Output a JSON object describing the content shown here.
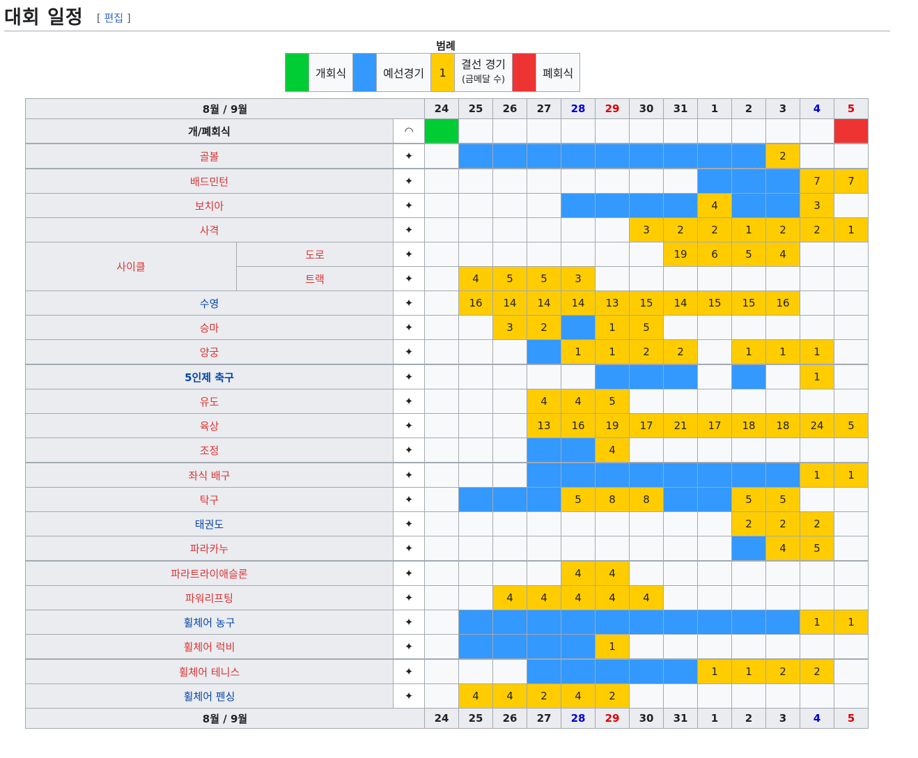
{
  "section": {
    "title": "대회 일정",
    "edit_open": "[",
    "edit_link": "편집",
    "edit_close": "]"
  },
  "legend": {
    "title": "범례",
    "opening": "개회식",
    "qualification": "예선경기",
    "final_number": "1",
    "final": "결선 경기",
    "final_sub": "(금메달 수)",
    "closing": "폐회식",
    "colors": {
      "opening": "#00cc33",
      "qualification": "#3399ff",
      "final": "#ffcc00",
      "closing": "#ee3333"
    }
  },
  "schedule": {
    "header_label": "8월 / 9월",
    "days": [
      "24",
      "25",
      "26",
      "27",
      "28",
      "29",
      "30",
      "31",
      "1",
      "2",
      "3",
      "4",
      "5"
    ],
    "ceremonies": {
      "label": "개/폐회식",
      "icon": "paralympic-agitos-icon"
    },
    "rows": [
      {
        "name": "골볼",
        "icon": "goalball-icon",
        "cells": [
          "",
          "Q",
          "Q",
          "Q",
          "Q",
          "Q",
          "Q",
          "Q",
          "Q",
          "Q",
          "2",
          "",
          ""
        ]
      },
      {
        "name": "배드민턴",
        "icon": "badminton-icon",
        "cells": [
          "",
          "",
          "",
          "",
          "",
          "",
          "",
          "",
          "Q",
          "Q",
          "Q",
          "7",
          "7"
        ]
      },
      {
        "name": "보치아",
        "icon": "boccia-icon",
        "cells": [
          "",
          "",
          "",
          "",
          "Q",
          "Q",
          "Q",
          "Q",
          "4",
          "Q",
          "Q",
          "3",
          ""
        ]
      },
      {
        "name": "사격",
        "icon": "shooting-icon",
        "cells": [
          "",
          "",
          "",
          "",
          "",
          "",
          "3",
          "2",
          "2",
          "1",
          "2",
          "2",
          "1"
        ]
      },
      {
        "group": "사이클",
        "name": "도로",
        "icon": "road-cycling-icon",
        "cells": [
          "",
          "",
          "",
          "",
          "",
          "",
          "",
          "19",
          "6",
          "5",
          "4",
          "",
          ""
        ]
      },
      {
        "name": "트랙",
        "icon": "track-cycling-icon",
        "cells": [
          "",
          "4",
          "5",
          "5",
          "3",
          "",
          "",
          "",
          "",
          "",
          "",
          "",
          ""
        ]
      },
      {
        "name": "수영",
        "icon": "swimming-icon",
        "cells": [
          "",
          "16",
          "14",
          "14",
          "14",
          "13",
          "15",
          "14",
          "15",
          "15",
          "16",
          "",
          ""
        ]
      },
      {
        "name": "승마",
        "icon": "equestrian-icon",
        "cells": [
          "",
          "",
          "3",
          "2",
          "Q",
          "1",
          "5",
          "",
          "",
          "",
          "",
          "",
          ""
        ]
      },
      {
        "name": "양궁",
        "icon": "archery-icon",
        "cells": [
          "",
          "",
          "",
          "Q",
          "1",
          "1",
          "2",
          "2",
          "",
          "1",
          "1",
          "1",
          ""
        ]
      },
      {
        "name": "5인제 축구",
        "icon": "football-5-icon",
        "cells": [
          "",
          "",
          "",
          "",
          "",
          "Q",
          "Q",
          "Q",
          "",
          "Q",
          "",
          "1",
          ""
        ]
      },
      {
        "name": "유도",
        "icon": "judo-icon",
        "cells": [
          "",
          "",
          "",
          "4",
          "4",
          "5",
          "",
          "",
          "",
          "",
          "",
          "",
          ""
        ]
      },
      {
        "name": "육상",
        "icon": "athletics-icon",
        "cells": [
          "",
          "",
          "",
          "13",
          "16",
          "19",
          "17",
          "21",
          "17",
          "18",
          "18",
          "24",
          "5"
        ]
      },
      {
        "name": "조정",
        "icon": "rowing-icon",
        "cells": [
          "",
          "",
          "",
          "Q",
          "Q",
          "4",
          "",
          "",
          "",
          "",
          "",
          "",
          ""
        ]
      },
      {
        "name": "좌식 배구",
        "icon": "sitting-volleyball-icon",
        "cells": [
          "",
          "",
          "",
          "Q",
          "Q",
          "Q",
          "Q",
          "Q",
          "Q",
          "Q",
          "Q",
          "1",
          "1"
        ]
      },
      {
        "name": "탁구",
        "icon": "table-tennis-icon",
        "cells": [
          "",
          "Q",
          "Q",
          "Q",
          "5",
          "8",
          "8",
          "Q",
          "Q",
          "5",
          "5",
          "",
          ""
        ]
      },
      {
        "name": "태권도",
        "icon": "taekwondo-icon",
        "cells": [
          "",
          "",
          "",
          "",
          "",
          "",
          "",
          "",
          "",
          "2",
          "2",
          "2",
          ""
        ]
      },
      {
        "name": "파라카누",
        "icon": "canoe-icon",
        "cells": [
          "",
          "",
          "",
          "",
          "",
          "",
          "",
          "",
          "",
          "Q",
          "4",
          "5",
          ""
        ]
      },
      {
        "name": "파라트라이애슬론",
        "icon": "triathlon-icon",
        "cells": [
          "",
          "",
          "",
          "",
          "4",
          "4",
          "",
          "",
          "",
          "",
          "",
          "",
          ""
        ]
      },
      {
        "name": "파워리프팅",
        "icon": "powerlifting-icon",
        "cells": [
          "",
          "",
          "4",
          "4",
          "4",
          "4",
          "4",
          "",
          "",
          "",
          "",
          "",
          ""
        ]
      },
      {
        "name": "휠체어 농구",
        "icon": "wheelchair-basketball-icon",
        "cells": [
          "",
          "Q",
          "Q",
          "Q",
          "Q",
          "Q",
          "Q",
          "Q",
          "Q",
          "Q",
          "Q",
          "1",
          "1"
        ]
      },
      {
        "name": "휠체어 럭비",
        "icon": "wheelchair-rugby-icon",
        "cells": [
          "",
          "Q",
          "Q",
          "Q",
          "Q",
          "1",
          "",
          "",
          "",
          "",
          "",
          "",
          ""
        ]
      },
      {
        "name": "휠체어 테니스",
        "icon": "wheelchair-tennis-icon",
        "cells": [
          "",
          "",
          "",
          "Q",
          "Q",
          "Q",
          "Q",
          "Q",
          "1",
          "1",
          "2",
          "2",
          ""
        ]
      },
      {
        "name": "휠체어 펜싱",
        "icon": "wheelchair-fencing-icon",
        "cells": [
          "",
          "4",
          "4",
          "2",
          "4",
          "2",
          "",
          "",
          "",
          "",
          "",
          "",
          ""
        ]
      }
    ]
  }
}
